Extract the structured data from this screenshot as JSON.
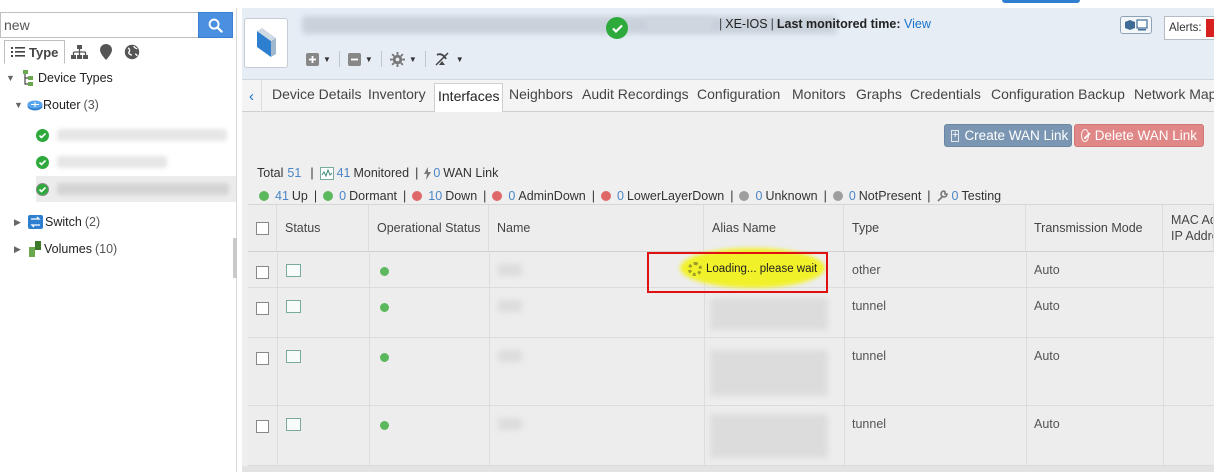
{
  "sidebar": {
    "search": {
      "value": "new"
    },
    "view_tabs": [
      {
        "label": "Type",
        "icon": "list-icon",
        "active": true
      },
      {
        "label": "",
        "icon": "hierarchy-icon"
      },
      {
        "label": "",
        "icon": "map-pin-icon"
      },
      {
        "label": "",
        "icon": "globe-icon"
      }
    ],
    "tree": {
      "root_label": "Device Types",
      "router": {
        "label": "Router",
        "count": "(3)"
      },
      "switch": {
        "label": "Switch",
        "count": "(2)"
      },
      "volumes": {
        "label": "Volumes",
        "count": "(10)"
      }
    }
  },
  "header": {
    "os": "XE-IOS",
    "last_monitored_label": "Last monitored time:",
    "last_monitored_link": "View",
    "alerts_label": "Alerts:",
    "tools": [
      "plus-icon",
      "minus-icon",
      "gear-icon",
      "satellite-icon"
    ]
  },
  "tabs": [
    "Device Details",
    "Inventory",
    "Interfaces",
    "Neighbors",
    "Audit Recordings",
    "Configuration",
    "Monitors",
    "Graphs",
    "Credentials",
    "Configuration Backup",
    "Network Map"
  ],
  "active_tab": "Interfaces",
  "actions": {
    "create_wan": "Create WAN Link",
    "delete_wan": "Delete WAN Link"
  },
  "summary": {
    "total_label": "Total",
    "total": "51",
    "monitored_count": "41",
    "monitored_label": "Monitored",
    "wan_count": "0",
    "wan_label": "WAN Link",
    "states": [
      {
        "count": "41",
        "label": "Up",
        "color": "#5cb85c"
      },
      {
        "count": "0",
        "label": "Dormant",
        "color": "#5cb85c"
      },
      {
        "count": "10",
        "label": "Down",
        "color": "#e06767"
      },
      {
        "count": "0",
        "label": "AdminDown",
        "color": "#e06767"
      },
      {
        "count": "0",
        "label": "LowerLayerDown",
        "color": "#e06767"
      },
      {
        "count": "0",
        "label": "Unknown",
        "color": "#9e9e9e"
      },
      {
        "count": "0",
        "label": "NotPresent",
        "color": "#9e9e9e"
      },
      {
        "count": "0",
        "label": "Testing",
        "color": "#888888"
      }
    ]
  },
  "table": {
    "columns": [
      "Status",
      "Operational Status",
      "Name",
      "Alias Name",
      "Type",
      "Transmission Mode",
      "MAC Add",
      "IP Addre"
    ],
    "rows": [
      {
        "type": "other",
        "mode": "Auto"
      },
      {
        "type": "tunnel",
        "mode": "Auto"
      },
      {
        "type": "tunnel",
        "mode": "Auto"
      },
      {
        "type": "tunnel",
        "mode": "Auto"
      }
    ]
  },
  "loading": {
    "text": "Loading... please wait"
  },
  "colors": {
    "accent": "#4a8fe0",
    "ok": "#2eaa3c",
    "create_btn": "#7b96b2",
    "delete_btn": "#e08888",
    "highlight": "#f2f21a",
    "annotation_box": "#e01010"
  }
}
